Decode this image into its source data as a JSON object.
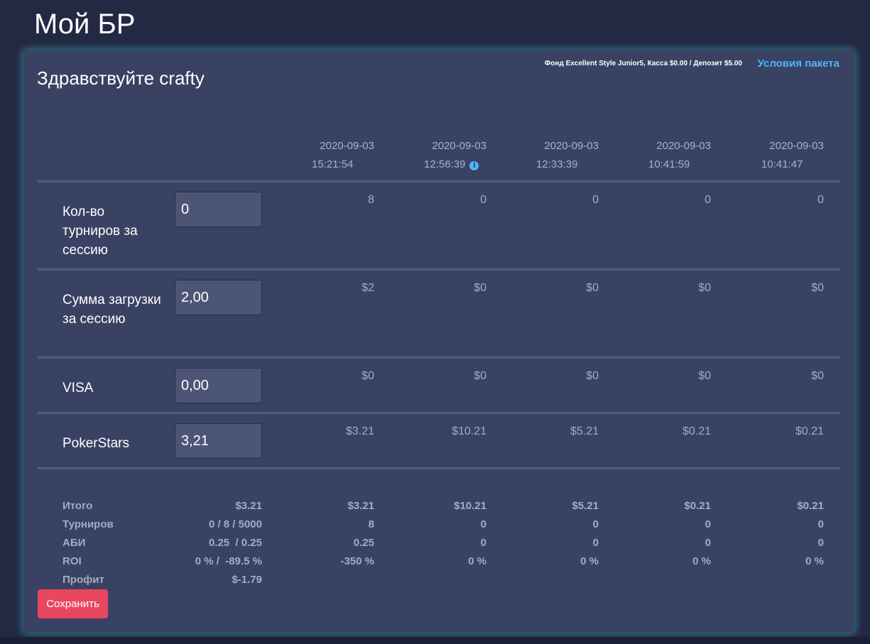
{
  "page": {
    "title": "Мой БР"
  },
  "card": {
    "greeting": "Здравствуйте crafty",
    "fund_info": "Фонд Excellent Style Junior5, Касса $0.00 / Депозит $5.00",
    "terms_link": "Условия пакета"
  },
  "sessions": [
    {
      "date": "2020-09-03",
      "time": "15:21:54",
      "info": false
    },
    {
      "date": "2020-09-03",
      "time": "12:56:39",
      "info": true
    },
    {
      "date": "2020-09-03",
      "time": "12:33:39",
      "info": false
    },
    {
      "date": "2020-09-03",
      "time": "10:41:59",
      "info": false
    },
    {
      "date": "2020-09-03",
      "time": "10:41:47",
      "info": false
    }
  ],
  "info_icon": "info-circle-icon",
  "rows": [
    {
      "label": "Кол-во турниров за сессию",
      "input": "0",
      "values": [
        "8",
        "0",
        "0",
        "0",
        "0"
      ]
    },
    {
      "label": "Сумма загрузки за сессию",
      "input": "2,00",
      "values": [
        "$2",
        "$0",
        "$0",
        "$0",
        "$0"
      ]
    },
    {
      "label": "VISA",
      "input": "0,00",
      "values": [
        "$0",
        "$0",
        "$0",
        "$0",
        "$0"
      ]
    },
    {
      "label": "PokerStars",
      "input": "3,21",
      "values": [
        "$3.21",
        "$10.21",
        "$5.21",
        "$0.21",
        "$0.21"
      ]
    }
  ],
  "summary": [
    {
      "label": "Итого",
      "current": "$3.21",
      "values": [
        "$3.21",
        "$10.21",
        "$5.21",
        "$0.21",
        "$0.21"
      ]
    },
    {
      "label": "Турниров",
      "current": "0 / 8 / 5000",
      "values": [
        "8",
        "0",
        "0",
        "0",
        "0"
      ]
    },
    {
      "label": "АБИ",
      "current": "0.25  / 0.25",
      "values": [
        "0.25",
        "0",
        "0",
        "0",
        "0"
      ]
    },
    {
      "label": "ROI",
      "current": "0 % /  -89.5 %",
      "values": [
        "-350 %",
        "0 %",
        "0 %",
        "0 %",
        "0 %"
      ]
    },
    {
      "label": "Профит",
      "current": "$-1.79",
      "values": []
    }
  ],
  "save_button": "Сохранить",
  "colors": {
    "accent": "#4bb7ff",
    "danger": "#e8475f",
    "card": "#3a4263",
    "background": "#232843"
  }
}
